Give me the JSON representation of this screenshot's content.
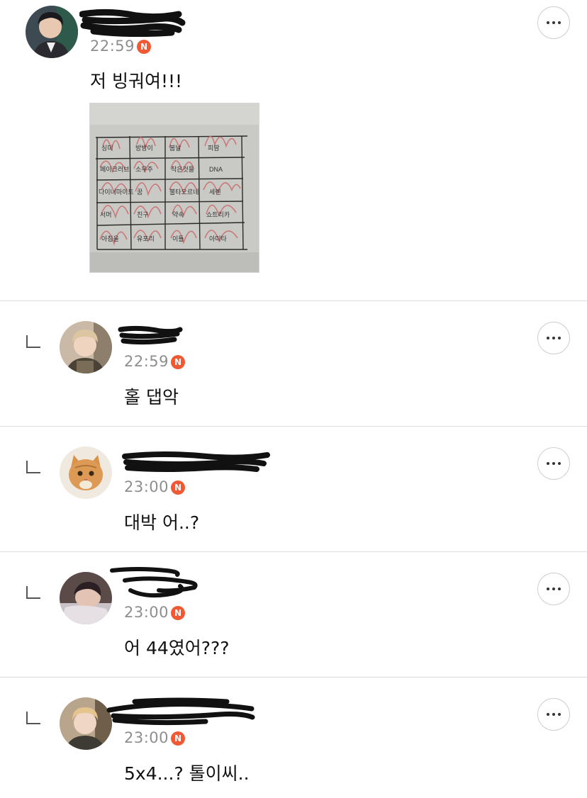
{
  "comments": [
    {
      "time": "22:59",
      "badge": "N",
      "text": "저 빙궈여!!!",
      "is_reply": false,
      "has_image": true
    },
    {
      "time": "22:59",
      "badge": "N",
      "text": "홀 댑악",
      "is_reply": true
    },
    {
      "time": "23:00",
      "badge": "N",
      "text": "대박 어..?",
      "is_reply": true
    },
    {
      "time": "23:00",
      "badge": "N",
      "text": "어 44였어???",
      "is_reply": true
    },
    {
      "time": "23:00",
      "badge": "N",
      "text": "5x4...? 톨이씨..",
      "is_reply": true
    }
  ],
  "bingo_image": {
    "cells": [
      [
        "싱미",
        "방방이",
        "봄날",
        "피땀"
      ],
      [
        "페이크러브",
        "소우주",
        "작은것들",
        "DNA"
      ],
      [
        "다이너마이트",
        "꿈",
        "불타오르네",
        "세렌"
      ],
      [
        "서머",
        "친구",
        "약속",
        "쇼트리카"
      ],
      [
        "아침을",
        "유포리",
        "이틀",
        "아미타"
      ]
    ]
  },
  "icons": {
    "more": "more-dots-icon",
    "reply": "reply-arrow-icon",
    "new": "new-badge-icon"
  },
  "colors": {
    "badge": "#ef5a34",
    "divider": "#dcdcdc",
    "timestamp": "#8e8e8e"
  }
}
